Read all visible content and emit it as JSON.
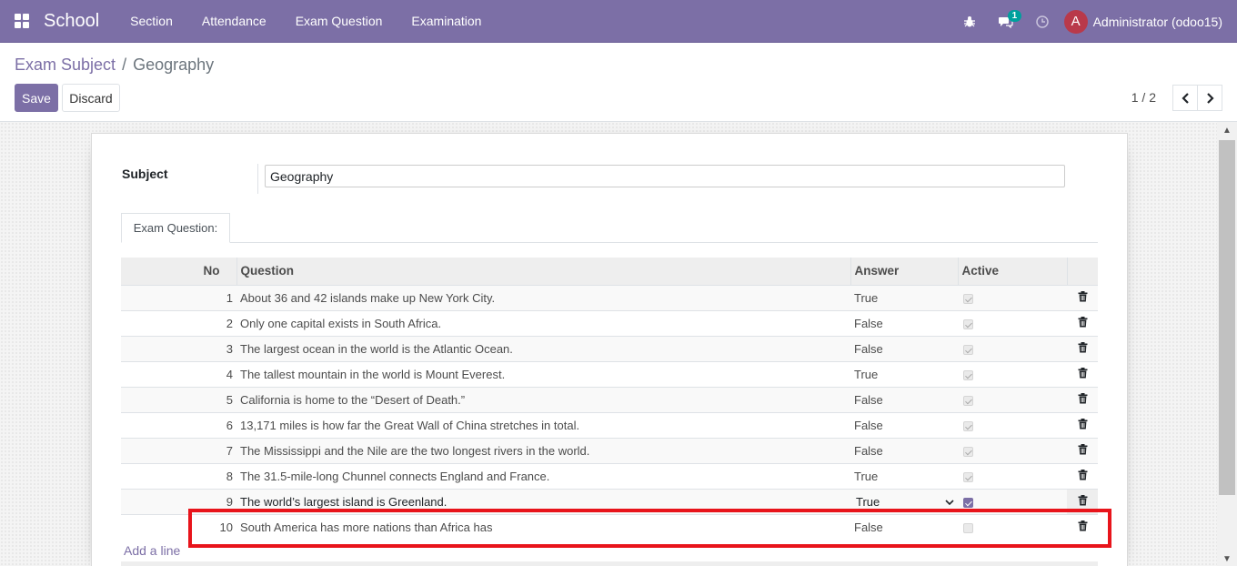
{
  "app": {
    "name": "School"
  },
  "menu": [
    "Section",
    "Attendance",
    "Exam Question",
    "Examination"
  ],
  "systray": {
    "chat_count": "1",
    "user_initial": "A",
    "user_name": "Administrator (odoo15)"
  },
  "breadcrumb": {
    "parent": "Exam Subject",
    "current": "Geography"
  },
  "buttons": {
    "save": "Save",
    "discard": "Discard"
  },
  "pager": {
    "value": "1 / 2"
  },
  "form": {
    "subject_label": "Subject",
    "subject_value": "Geography"
  },
  "tab": {
    "label": "Exam Question:"
  },
  "table": {
    "headers": {
      "no": "No",
      "question": "Question",
      "answer": "Answer",
      "active": "Active"
    },
    "rows": [
      {
        "no": "1",
        "question": "About 36 and 42 islands make up New York City.",
        "answer": "True",
        "active": true
      },
      {
        "no": "2",
        "question": "Only one capital exists in South Africa.",
        "answer": "False",
        "active": true
      },
      {
        "no": "3",
        "question": "The largest ocean in the world is the Atlantic Ocean.",
        "answer": "False",
        "active": true
      },
      {
        "no": "4",
        "question": "The tallest mountain in the world is Mount Everest.",
        "answer": "True",
        "active": true
      },
      {
        "no": "5",
        "question": "California is home to the “Desert of Death.”",
        "answer": "False",
        "active": true
      },
      {
        "no": "6",
        "question": "13,171 miles is how far the Great Wall of China stretches in total.",
        "answer": "False",
        "active": true
      },
      {
        "no": "7",
        "question": "The Mississippi and the Nile are the two longest rivers in the world.",
        "answer": "False",
        "active": true
      },
      {
        "no": "8",
        "question": "The 31.5-mile-long Chunnel connects England and France.",
        "answer": "True",
        "active": true
      },
      {
        "no": "9",
        "question": "The world’s largest island is Greenland.",
        "answer": "True",
        "active": true
      },
      {
        "no": "10",
        "question": "South America has more nations than Africa has",
        "answer": "False",
        "active": false
      }
    ]
  },
  "add_line": "Add a line",
  "colors": {
    "brand": "#7c6fa6",
    "highlight": "#e8141b",
    "badge": "#00a09d",
    "avatar": "#b9394a"
  }
}
